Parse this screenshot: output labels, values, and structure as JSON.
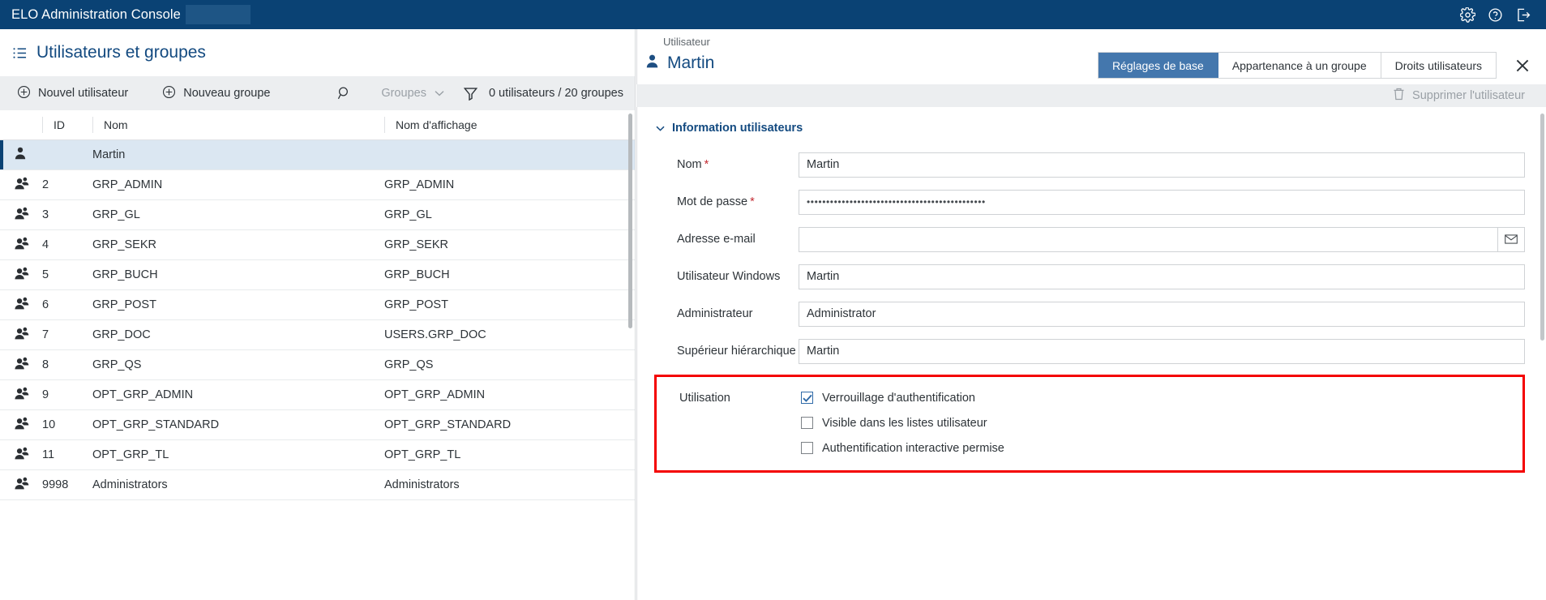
{
  "topbar": {
    "app_title": "ELO Administration Console",
    "icons": [
      {
        "name": "gear-icon",
        "label": "Paramètres"
      },
      {
        "name": "help-icon",
        "label": "Aide"
      },
      {
        "name": "logout-icon",
        "label": "Déconnexion"
      }
    ]
  },
  "left": {
    "page_title": "Utilisateurs et groupes",
    "list_icon": "list-icon",
    "toolbar": {
      "new_user": "Nouvel utilisateur",
      "new_group": "Nouveau groupe",
      "search_icon": "search-icon",
      "filter_select": "Groupes",
      "filter_icon": "filter-icon",
      "count": "0 utilisateurs / 20 groupes"
    },
    "columns": [
      "",
      "ID",
      "Nom",
      "Nom d'affichage"
    ],
    "rows": [
      {
        "icon": "user-icon",
        "id": "",
        "nom": "Martin",
        "disp": "",
        "selected": true
      },
      {
        "icon": "group-icon",
        "id": "2",
        "nom": "GRP_ADMIN",
        "disp": "GRP_ADMIN",
        "selected": false
      },
      {
        "icon": "group-icon",
        "id": "3",
        "nom": "GRP_GL",
        "disp": "GRP_GL",
        "selected": false
      },
      {
        "icon": "group-icon",
        "id": "4",
        "nom": "GRP_SEKR",
        "disp": "GRP_SEKR",
        "selected": false
      },
      {
        "icon": "group-icon",
        "id": "5",
        "nom": "GRP_BUCH",
        "disp": "GRP_BUCH",
        "selected": false
      },
      {
        "icon": "group-icon",
        "id": "6",
        "nom": "GRP_POST",
        "disp": "GRP_POST",
        "selected": false
      },
      {
        "icon": "group-icon",
        "id": "7",
        "nom": "GRP_DOC",
        "disp": "USERS.GRP_DOC",
        "selected": false
      },
      {
        "icon": "group-icon",
        "id": "8",
        "nom": "GRP_QS",
        "disp": "GRP_QS",
        "selected": false
      },
      {
        "icon": "group-icon",
        "id": "9",
        "nom": "OPT_GRP_ADMIN",
        "disp": "OPT_GRP_ADMIN",
        "selected": false
      },
      {
        "icon": "group-icon",
        "id": "10",
        "nom": "OPT_GRP_STANDARD",
        "disp": "OPT_GRP_STANDARD",
        "selected": false
      },
      {
        "icon": "group-icon",
        "id": "11",
        "nom": "OPT_GRP_TL",
        "disp": "OPT_GRP_TL",
        "selected": false
      },
      {
        "icon": "group-icon",
        "id": "9998",
        "nom": "Administrators",
        "disp": "Administrators",
        "selected": false
      }
    ]
  },
  "right": {
    "breadcrumb": "Utilisateur",
    "user_name": "Martin",
    "tabs": [
      {
        "label": "Réglages de base",
        "active": true
      },
      {
        "label": "Appartenance à un groupe",
        "active": false
      },
      {
        "label": "Droits utilisateurs",
        "active": false
      }
    ],
    "close_icon": "close-icon",
    "delete_user": "Supprimer l'utilisateur",
    "section_title": "Information utilisateurs",
    "fields": [
      {
        "label": "Nom",
        "required": true,
        "value": "Martin",
        "placeholder": "",
        "type": "text"
      },
      {
        "label": "Mot de passe",
        "required": true,
        "value": "••••••••••••••••••••••••••••••••••••••••••••••",
        "placeholder": "",
        "type": "password"
      },
      {
        "label": "Adresse e-mail",
        "required": false,
        "value": "",
        "placeholder": "",
        "type": "email"
      },
      {
        "label": "Utilisateur Windows",
        "required": false,
        "value": "Martin",
        "placeholder": "",
        "type": "text"
      },
      {
        "label": "Administrateur",
        "required": false,
        "value": "Administrator",
        "placeholder": "",
        "type": "text"
      },
      {
        "label": "Supérieur hiérarchique",
        "required": false,
        "value": "Martin",
        "placeholder": "",
        "type": "text"
      }
    ],
    "usage": {
      "label": "Utilisation",
      "highlight_color": "#f40000",
      "options": [
        {
          "label": "Verrouillage d'authentification",
          "checked": true
        },
        {
          "label": "Visible dans les listes utilisateur",
          "checked": false
        },
        {
          "label": "Authentification interactive permise",
          "checked": false
        }
      ]
    }
  },
  "colors": {
    "brand": "#0a4274",
    "accent": "#4477ad",
    "link": "#134a80",
    "highlight": "#f40000"
  }
}
